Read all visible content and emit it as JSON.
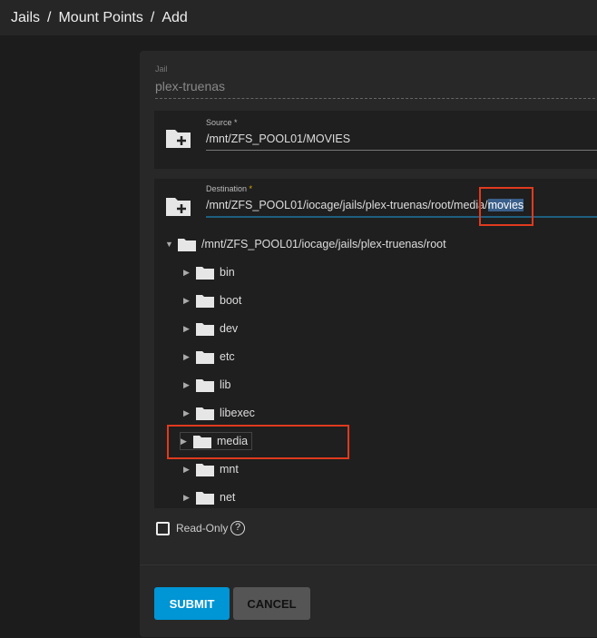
{
  "breadcrumb": [
    "Jails",
    "Mount Points",
    "Add"
  ],
  "jail": {
    "label": "Jail",
    "value": "plex-truenas"
  },
  "source": {
    "label": "Source",
    "required": "*",
    "value": "/mnt/ZFS_POOL01/MOVIES"
  },
  "destination": {
    "label": "Destination",
    "required": "*",
    "value_prefix": "/mnt/ZFS_POOL01/iocage/jails/plex-truenas/root/media/",
    "value_selected": "movies"
  },
  "tree": {
    "root": "/mnt/ZFS_POOL01/iocage/jails/plex-truenas/root",
    "children": [
      "bin",
      "boot",
      "dev",
      "etc",
      "lib",
      "libexec",
      "media",
      "mnt",
      "net"
    ]
  },
  "read_only": {
    "label": "Read-Only",
    "checked": false
  },
  "buttons": {
    "submit": "SUBMIT",
    "cancel": "CANCEL"
  },
  "colors": {
    "accent": "#0095d5",
    "highlight": "#e03a1e"
  }
}
